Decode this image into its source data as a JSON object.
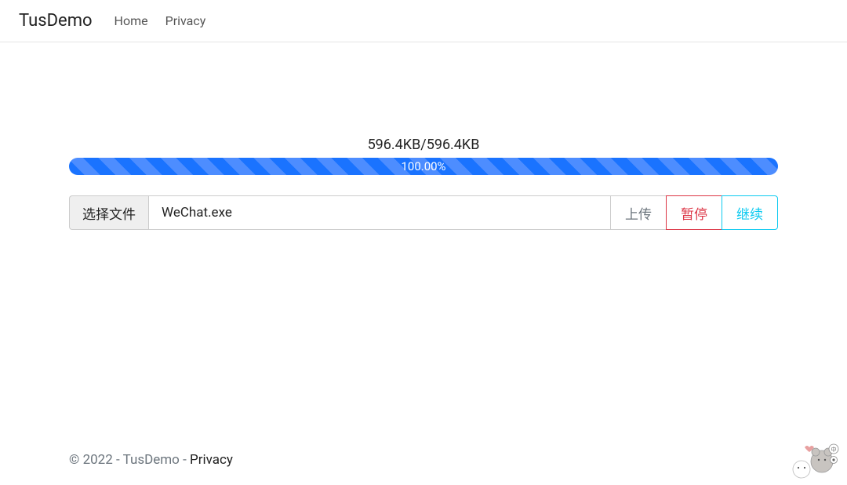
{
  "navbar": {
    "brand": "TusDemo",
    "links": {
      "home": "Home",
      "privacy": "Privacy"
    }
  },
  "upload": {
    "status_text": "596.4KB/596.4KB",
    "progress_percent": "100.00%",
    "file_select_label": "选择文件",
    "file_name": "WeChat.exe",
    "buttons": {
      "upload": "上传",
      "pause": "暂停",
      "resume": "继续"
    }
  },
  "footer": {
    "copyright": "© 2022 - TusDemo - ",
    "privacy_link": "Privacy"
  }
}
